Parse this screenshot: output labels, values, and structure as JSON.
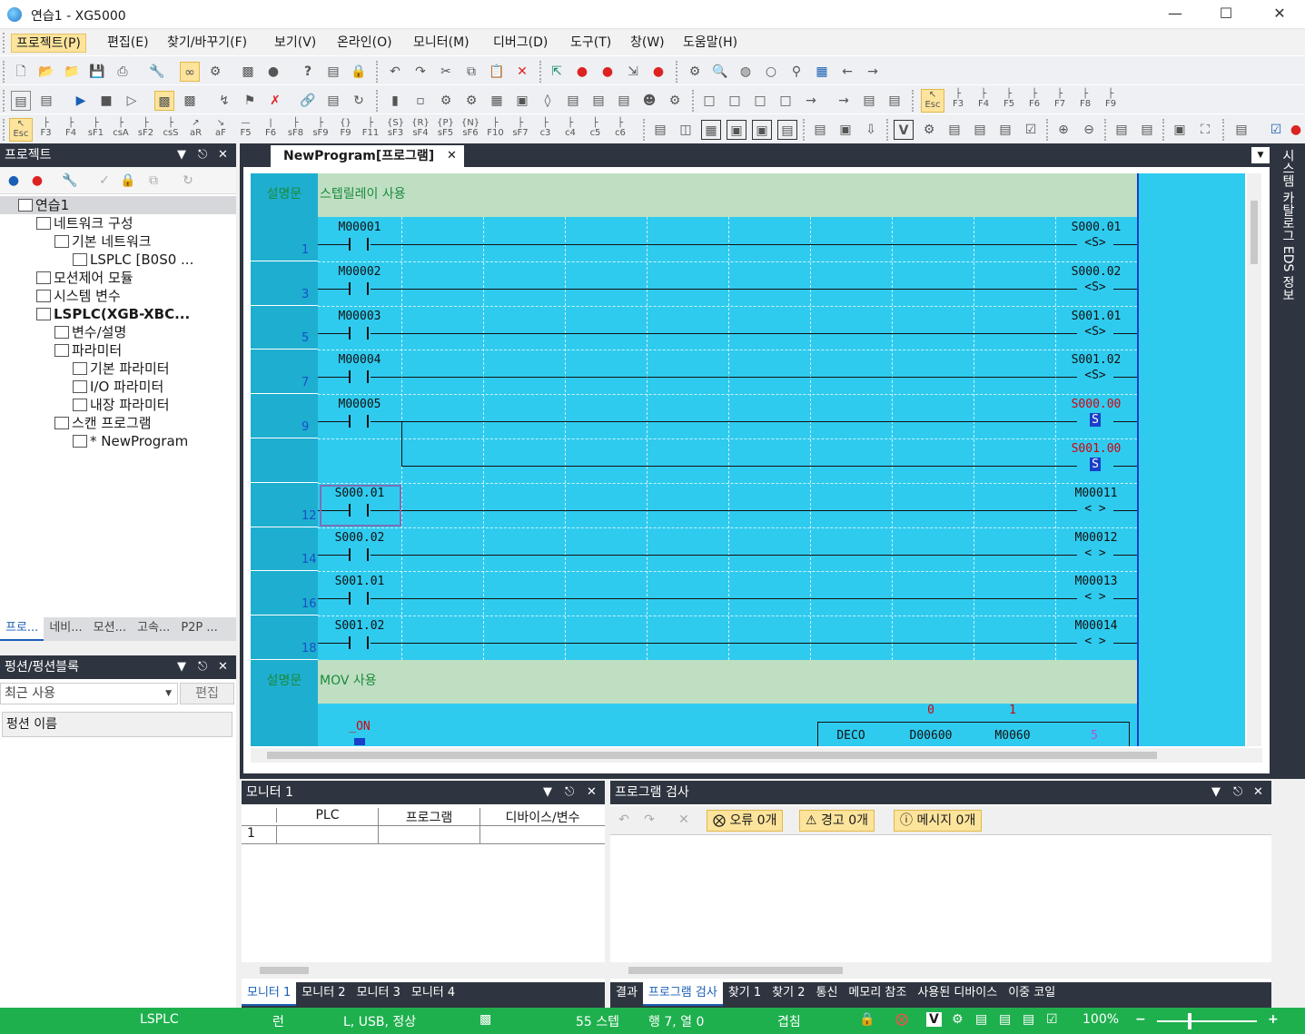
{
  "window": {
    "title": "연습1 - XG5000"
  },
  "menu": [
    "프로젝트(P)",
    "편집(E)",
    "찾기/바꾸기(F)",
    "보기(V)",
    "온라인(O)",
    "모니터(M)",
    "디버그(D)",
    "도구(T)",
    "창(W)",
    "도움말(H)"
  ],
  "toolbar3_labels": [
    "Esc",
    "F3",
    "F4",
    "sF1",
    "csA",
    "sF2",
    "csS",
    "aR",
    "aF",
    "F5",
    "F6",
    "sF8",
    "sF9",
    "F9",
    "F11",
    "sF3",
    "sF4",
    "sF5",
    "sF6",
    "F10",
    "sF7",
    "c3",
    "c4",
    "c5",
    "c6"
  ],
  "toolbar2_labels": [
    "Esc",
    "F3",
    "F4",
    "F5",
    "F6",
    "F7",
    "F8",
    "F9"
  ],
  "project_panel": {
    "title": "프로젝트",
    "tree": [
      {
        "label": "연습1",
        "level": 0
      },
      {
        "label": "네트워크 구성",
        "level": 1
      },
      {
        "label": "기본 네트워크",
        "level": 2
      },
      {
        "label": "LSPLC [B0S0 ...",
        "level": 3
      },
      {
        "label": "모션제어 모듈",
        "level": 1
      },
      {
        "label": "시스템 변수",
        "level": 1
      },
      {
        "label": "LSPLC(XGB-XBC...",
        "level": 1
      },
      {
        "label": "변수/설명",
        "level": 2
      },
      {
        "label": "파라미터",
        "level": 2
      },
      {
        "label": "기본 파라미터",
        "level": 3
      },
      {
        "label": "I/O 파라미터",
        "level": 3
      },
      {
        "label": "내장 파라미터",
        "level": 3
      },
      {
        "label": "스캔 프로그램",
        "level": 2
      },
      {
        "label": "* NewProgram",
        "level": 3
      }
    ],
    "tabs": [
      "프로...",
      "네비...",
      "모션...",
      "고속...",
      "P2P ..."
    ]
  },
  "func_panel": {
    "title": "펑션/펑션블록",
    "combo": "최근 사용",
    "edit_button": "편집",
    "column": "펑션 이름"
  },
  "doc": {
    "tab": "NewProgram[프로그램]"
  },
  "ladder": {
    "comment1_label": "설명문",
    "comment1": "스텝릴레이 사용",
    "comment2_label": "설명문",
    "comment2": "MOV 사용",
    "rungs": [
      {
        "step": "1",
        "contact": "M00001",
        "coil_dev": "S000.01",
        "coil": "<S>"
      },
      {
        "step": "3",
        "contact": "M00002",
        "coil_dev": "S000.02",
        "coil": "<S>"
      },
      {
        "step": "5",
        "contact": "M00003",
        "coil_dev": "S001.01",
        "coil": "<S>"
      },
      {
        "step": "7",
        "contact": "M00004",
        "coil_dev": "S001.02",
        "coil": "<S>"
      },
      {
        "step": "9",
        "contact": "M00005",
        "coil_dev": "S000.00",
        "coil": "S"
      },
      {
        "step": "",
        "contact": "",
        "coil_dev": "S001.00",
        "coil": "S"
      },
      {
        "step": "12",
        "contact": "S000.01",
        "coil_dev": "M00011",
        "coil": "< >"
      },
      {
        "step": "14",
        "contact": "S000.02",
        "coil_dev": "M00012",
        "coil": "< >"
      },
      {
        "step": "16",
        "contact": "S001.01",
        "coil_dev": "M00013",
        "coil": "< >"
      },
      {
        "step": "18",
        "contact": "S001.02",
        "coil_dev": "M00014",
        "coil": "< >"
      }
    ],
    "last": {
      "contact": "_ON",
      "func": "DECO",
      "op1": "D00600",
      "op2": "M0060",
      "op3": "5",
      "val1": "0",
      "val2": "1"
    }
  },
  "right_vtab": "시스템 카탈로그  EDS 정보",
  "monitor": {
    "title": "모니터 1",
    "cols": [
      "PLC",
      "프로그램",
      "디바이스/변수"
    ],
    "row": "1",
    "tabs": [
      "모니터 1",
      "모니터 2",
      "모니터 3",
      "모니터 4"
    ]
  },
  "check": {
    "title": "프로그램 검사",
    "error": "오류 0개",
    "warn": "경고 0개",
    "msg": "메시지 0개",
    "tabs": [
      "결과",
      "프로그램 검사",
      "찾기 1",
      "찾기 2",
      "통신",
      "메모리 참조",
      "사용된 디바이스",
      "이중 코일"
    ]
  },
  "status": {
    "plc": "LSPLC",
    "mode": "런",
    "conn": "L, USB, 정상",
    "steps": "55 스텝",
    "pos": "행 7, 열 0",
    "ovr": "겹침",
    "zoom": "100%"
  },
  "colors": {
    "ladder_bg": "#2fcbef",
    "rail": "#1a3fc8",
    "comment_bg": "#bfdfc3",
    "status_bg": "#1fb04e",
    "active_coil": "#d3000b"
  }
}
